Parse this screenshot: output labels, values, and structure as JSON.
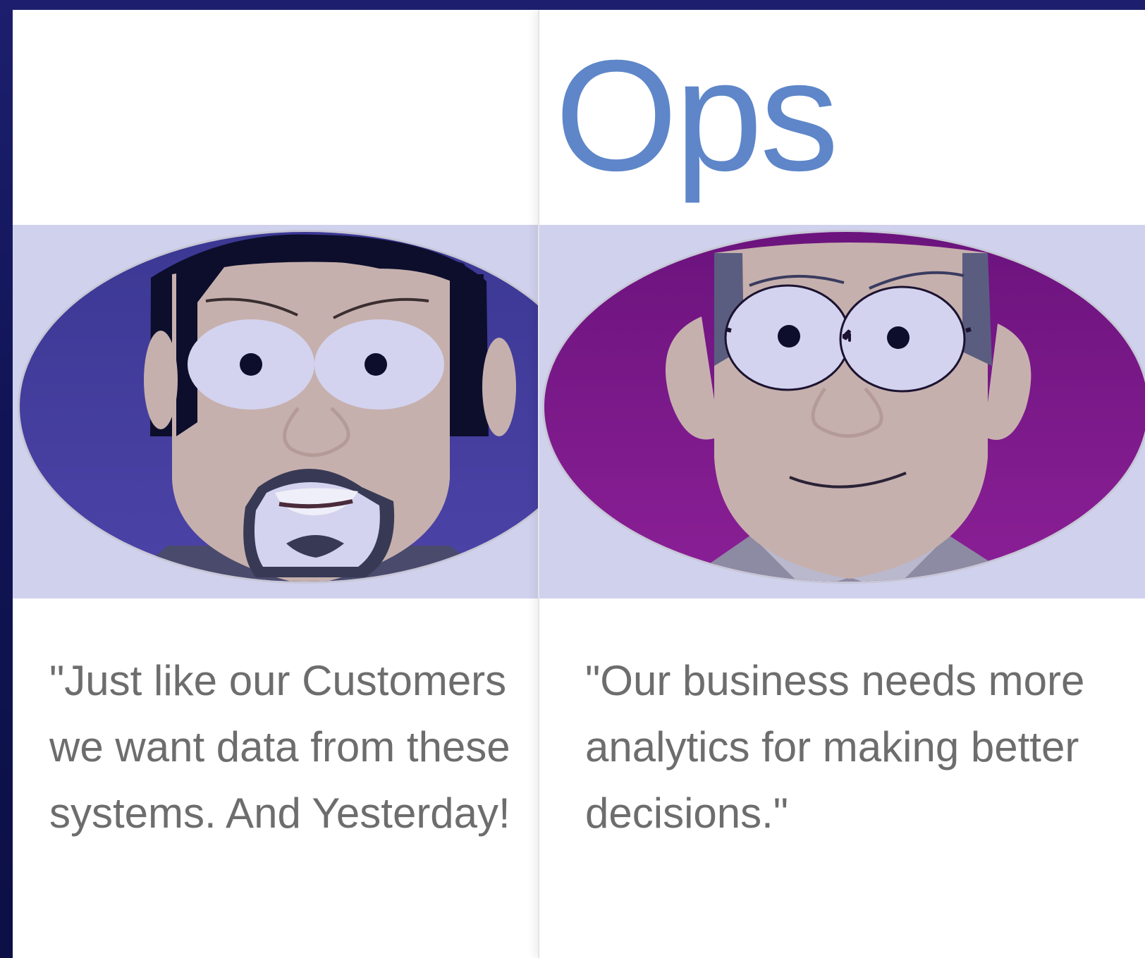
{
  "personas": [
    {
      "title": "",
      "quote_lines": [
        "\"Just like our Customers",
        "we want data from these",
        "systems. And Yesterday!"
      ],
      "background_color": "#4a3fa2",
      "icon": "developer-avatar-icon"
    },
    {
      "title": "Ops",
      "quote_lines": [
        "\"Our business needs more",
        "analytics for making better",
        "decisions.\""
      ],
      "background_color": "#861e90",
      "icon": "manager-avatar-icon"
    }
  ],
  "colors": {
    "title": "#5e86c9",
    "quote_text": "#6d6d6d",
    "band": "#d0d1ec",
    "frame": "#101455"
  }
}
